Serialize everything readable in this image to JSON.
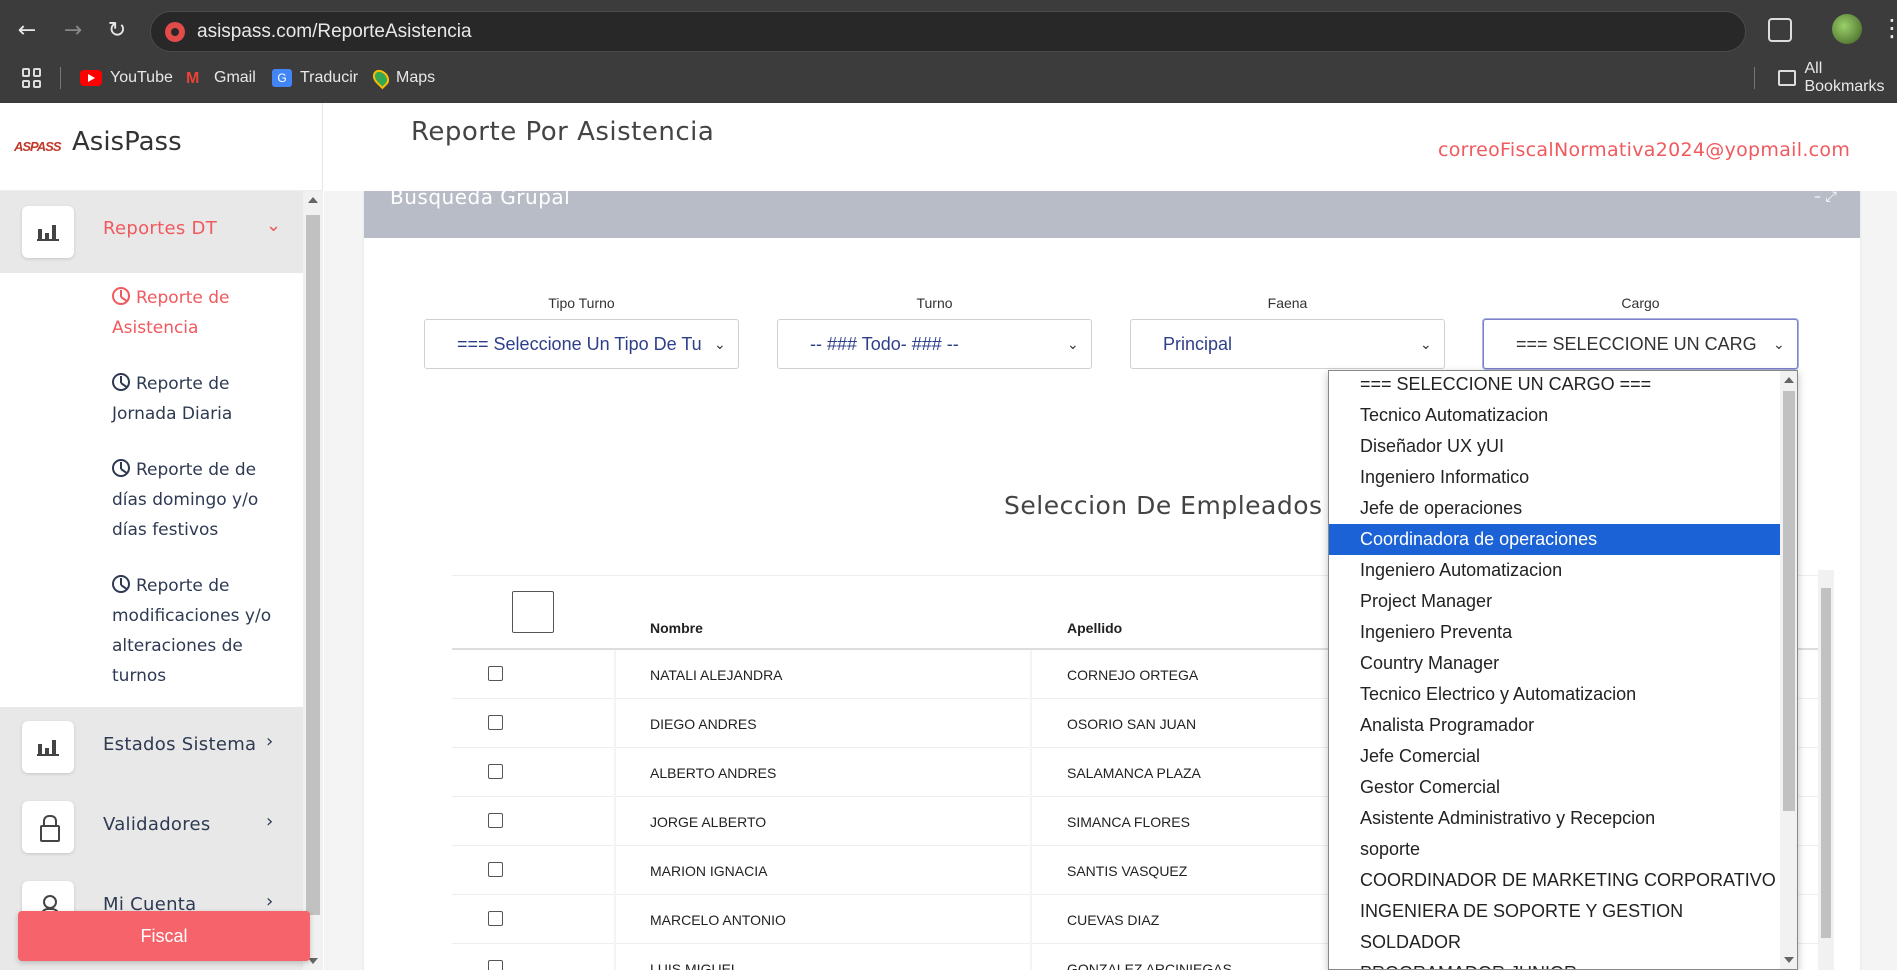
{
  "browser": {
    "url": "asispass.com/ReporteAsistencia",
    "bookmarks": [
      {
        "label": "YouTube",
        "icon": "youtube-icon"
      },
      {
        "label": "Gmail",
        "icon": "gmail-icon"
      },
      {
        "label": "Traducir",
        "icon": "translate-icon"
      },
      {
        "label": "Maps",
        "icon": "maps-icon"
      }
    ],
    "all_bookmarks_label": "All Bookmarks"
  },
  "brand": {
    "logo_text": "ASPASS",
    "name": "AsisPass"
  },
  "sidebar": {
    "reportes_label": "Reportes DT",
    "reportes_chevron": "⌄",
    "sub_items": [
      "Reporte de Asistencia",
      "Reporte de Jornada Diaria",
      "Reporte de de días domingo y/o días festivos",
      "Reporte de modificaciones y/o alteraciones de turnos"
    ],
    "estados_label": "Estados Sistema",
    "validadores_label": "Validadores",
    "cuenta_label": "Mi Cuenta",
    "chevron": "›",
    "fiscal_button": "Fiscal"
  },
  "header": {
    "page_title": "Reporte Por Asistencia",
    "user_email": "correoFiscalNormativa2024@yopmail.com"
  },
  "card": {
    "title": "Busqueda Grupal",
    "tools": "–  ⤢"
  },
  "filters": {
    "tipo_turno": {
      "label": "Tipo Turno",
      "value": "=== Seleccione Un Tipo De Tu"
    },
    "turno": {
      "label": "Turno",
      "value": "-- ### Todo- ### --"
    },
    "faena": {
      "label": "Faena",
      "value": "Principal"
    },
    "cargo": {
      "label": "Cargo",
      "value": "=== SELECCIONE UN CARG"
    }
  },
  "employees": {
    "section_title": "Seleccion De Empleados",
    "columns": [
      "Nombre",
      "Apellido"
    ],
    "rows": [
      {
        "nombre": "NATALI ALEJANDRA",
        "apellido": "CORNEJO ORTEGA"
      },
      {
        "nombre": "DIEGO ANDRES",
        "apellido": "OSORIO SAN JUAN"
      },
      {
        "nombre": "ALBERTO ANDRES",
        "apellido": "SALAMANCA PLAZA"
      },
      {
        "nombre": "JORGE ALBERTO",
        "apellido": "SIMANCA FLORES"
      },
      {
        "nombre": "MARION IGNACIA",
        "apellido": "SANTIS VASQUEZ"
      },
      {
        "nombre": "MARCELO ANTONIO",
        "apellido": "CUEVAS DIAZ"
      },
      {
        "nombre": "LUIS MIGUEL",
        "apellido": "GONZALEZ ARCINIEGAS"
      }
    ]
  },
  "cargo_options": [
    "=== SELECCIONE UN CARGO ===",
    "Tecnico Automatizacion",
    "Diseñador UX yUI",
    "Ingeniero Informatico",
    "Jefe de operaciones",
    "Coordinadora de operaciones",
    "Ingeniero Automatizacion",
    "Project Manager",
    "Ingeniero Preventa",
    "Country Manager",
    "Tecnico Electrico y Automatizacion",
    "Analista Programador",
    "Jefe Comercial",
    "Gestor Comercial",
    "Asistente Administrativo y Recepcion",
    "soporte",
    "COORDINADOR DE MARKETING CORPORATIVO",
    "INGENIERA DE SOPORTE Y GESTION",
    "SOLDADOR",
    "PROGRAMADOR JUNIOR"
  ],
  "cargo_selected_option": "Coordinadora de operaciones",
  "colors": {
    "accent": "#f0595e",
    "selected_option": "#1a62d6",
    "chrome": "#3c3c3c"
  }
}
